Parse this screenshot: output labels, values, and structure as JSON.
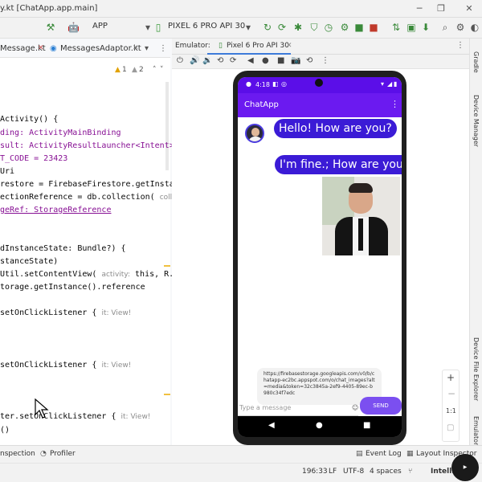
{
  "window": {
    "title": "y.kt [ChatApp.app.main]"
  },
  "toolbar": {
    "app_config": "APP",
    "device": "PIXEL 6 PRO API 30"
  },
  "editor": {
    "tabs": [
      "Message.kt",
      "MessagesAdaptor.kt"
    ],
    "warnings": "1",
    "weak_warnings": "2",
    "lines": [
      {
        "text": "Activity() {"
      },
      {
        "text": "ding: ActivityMainBinding"
      },
      {
        "text": "sult: ActivityResultLauncher<Intent>"
      },
      {
        "text": "T_CODE = 23423"
      },
      {
        "text": "Uri"
      },
      {
        "text": "restore = FirebaseFirestore.getInsta"
      },
      {
        "text": "ectionReference = db.collection(",
        "hint": "colle"
      },
      {
        "text": "geRef: StorageReference"
      },
      {
        "text": "dInstanceState: Bundle?) {"
      },
      {
        "text": "stanceState)"
      },
      {
        "text": "Util.setContentView(",
        "hint": "activity:",
        "rest": " this, R.la"
      },
      {
        "text": "torage.getInstance().reference"
      },
      {
        "text": "setOnClickListener {",
        "hint": "it: View!"
      },
      {
        "text": "setOnClickListener {",
        "hint": "it: View!"
      },
      {
        "text": "ter.setOnClickListener {",
        "hint": "it: View!"
      },
      {
        "text": "()"
      }
    ]
  },
  "emulator": {
    "label": "Emulator:",
    "tab": "Pixel 6 Pro API 30"
  },
  "phone": {
    "time": "4:18",
    "app_title": "ChatApp",
    "messages": [
      {
        "text": "Hello! How are you?"
      },
      {
        "text": "I'm fine.; How are you?"
      }
    ],
    "url_text": "https://firebasestorage.googleapis.com/v0/b/chatapp-ec2bc.appspot.com/o/chat_images?alt=media&token=32c3845a-2ef9-4405-89ec-b980c34f7edc",
    "input_placeholder": "Type a message",
    "send_label": "SEND",
    "zoom_label": "1:1"
  },
  "right_strip": {
    "gradle": "Gradle",
    "device_manager": "Device Manager",
    "device_file_explorer": "Device File Explorer",
    "emulator": "Emulator"
  },
  "bottom_tools": {
    "inspection": "nspection",
    "profiler": "Profiler",
    "event_log": "Event Log",
    "layout_inspector": "Layout Inspector"
  },
  "status": {
    "position": "196:33",
    "line_sep": "LF",
    "encoding": "UTF-8",
    "indent": "4 spaces",
    "ide": "IntelliJ"
  },
  "colors": {
    "accent": "#6b1af0",
    "bubble": "#3b1bd6",
    "send": "#7b4ff0"
  }
}
